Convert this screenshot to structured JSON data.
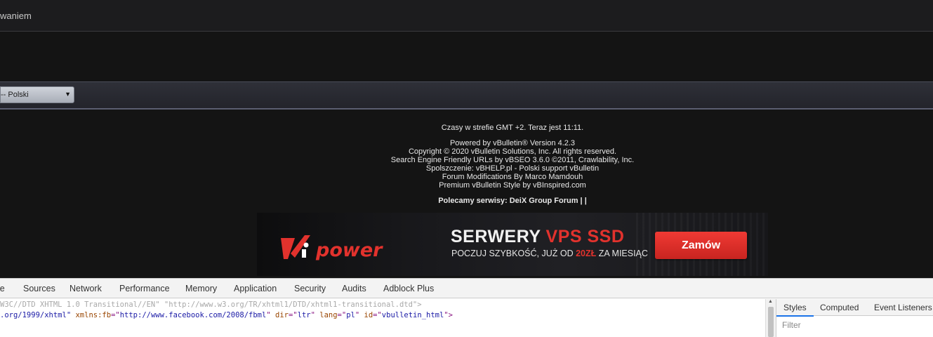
{
  "topbar": {
    "text": "waniem"
  },
  "language_select": {
    "value": "-- Polski",
    "arrow": "▼"
  },
  "footer": {
    "timezone": "Czasy w strefie GMT +2. Teraz jest 11:11.",
    "powered_prefix": "Powered by ",
    "powered_link": "vBulletin®",
    "powered_suffix": " Version 4.2.3",
    "copyright": "Copyright © 2020 vBulletin Solutions, Inc. All rights reserved.",
    "seo": "Search Engine Friendly URLs by vBSEO 3.6.0 ©2011, Crawlability, Inc.",
    "sponsor": "Spolszczenie: vBHELP.pl - Polski support vBulletin",
    "mods_prefix": "Forum Modifications By ",
    "mods_link": "Marco Mamdouh",
    "style_prefix": "Premium vBulletin Style by ",
    "style_link": "vBInspired.com",
    "recommend_label": "Polecamy serwisy:",
    "recommend_link": "DeiX Group Forum",
    "recommend_suffix": " | |"
  },
  "banner": {
    "logo_text": "Vipower",
    "headline_white": "SERWERY ",
    "headline_red": "VPS SSD",
    "sub_prefix": "POCZUJ SZYBKOŚĆ, JUŻ OD ",
    "sub_price": "20ZŁ",
    "sub_suffix": " ZA MIESIĄC",
    "cta_label": "Zamów",
    "colors": {
      "accent": "#e2322d",
      "button": "#d92d28"
    }
  },
  "devtools": {
    "tabs": [
      "le",
      "Sources",
      "Network",
      "Performance",
      "Memory",
      "Application",
      "Security",
      "Audits",
      "Adblock Plus"
    ],
    "code_line1": "W3C//DTD XHTML 1.0 Transitional//EN\" \"http://www.w3.org/TR/xhtml1/DTD/xhtml1-transitional.dtd\">",
    "code_line2": {
      "part1": ".org/1999/xhtml\"",
      "attr1": " xmlns:fb",
      "eq1": "=\"",
      "val1": "http://www.facebook.com/2008/fbml",
      "q1": "\"",
      "attr2": " dir",
      "eq2": "=\"",
      "val2": "ltr",
      "q2": "\"",
      "attr3": " lang",
      "eq3": "=\"",
      "val3": "pl",
      "q3": "\"",
      "attr4": " id",
      "eq4": "=\"",
      "val4": "vbulletin_html",
      "q4": "\">"
    },
    "side_tabs": [
      "Styles",
      "Computed",
      "Event Listeners"
    ],
    "filter_placeholder": "Filter"
  }
}
